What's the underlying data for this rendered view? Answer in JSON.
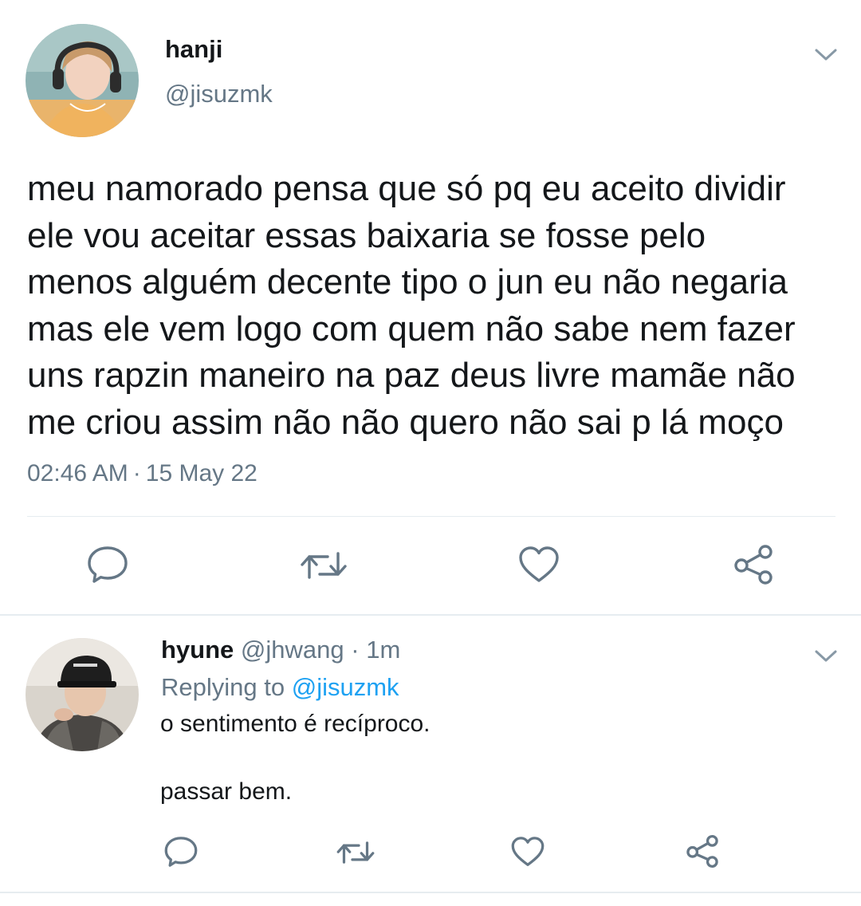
{
  "tweet": {
    "author_name": "hanji",
    "author_handle": "@jisuzmk",
    "text_lines": [
      "meu namorado pensa que só pq eu aceito dividir",
      "ele vou aceitar essas baixaria se fosse pelo",
      "menos alguém decente tipo o jun eu não negaria",
      "mas ele vem logo com quem não sabe nem fazer",
      "uns rapzin maneiro na paz deus livre mamãe não",
      "me criou assim não não quero não sai p lá moço"
    ],
    "time": "02:46 AM",
    "separator": "·",
    "date": "15 May 22",
    "actions": [
      "reply-icon",
      "retweet-icon",
      "like-icon",
      "share-icon"
    ]
  },
  "reply": {
    "author_name": "hyune",
    "author_handle": "@jhwang",
    "separator": "·",
    "age": "1m",
    "replying_prefix": "Replying to",
    "replying_to": "@jisuzmk",
    "text_line1": "o sentimento é recíproco.",
    "text_line2": "passar bem.",
    "actions": [
      "reply-icon",
      "retweet-icon",
      "like-icon",
      "share-icon"
    ]
  },
  "colors": {
    "text": "#14171a",
    "secondary": "#657786",
    "accent": "#1da1f2",
    "divider": "#e6ecf0"
  }
}
